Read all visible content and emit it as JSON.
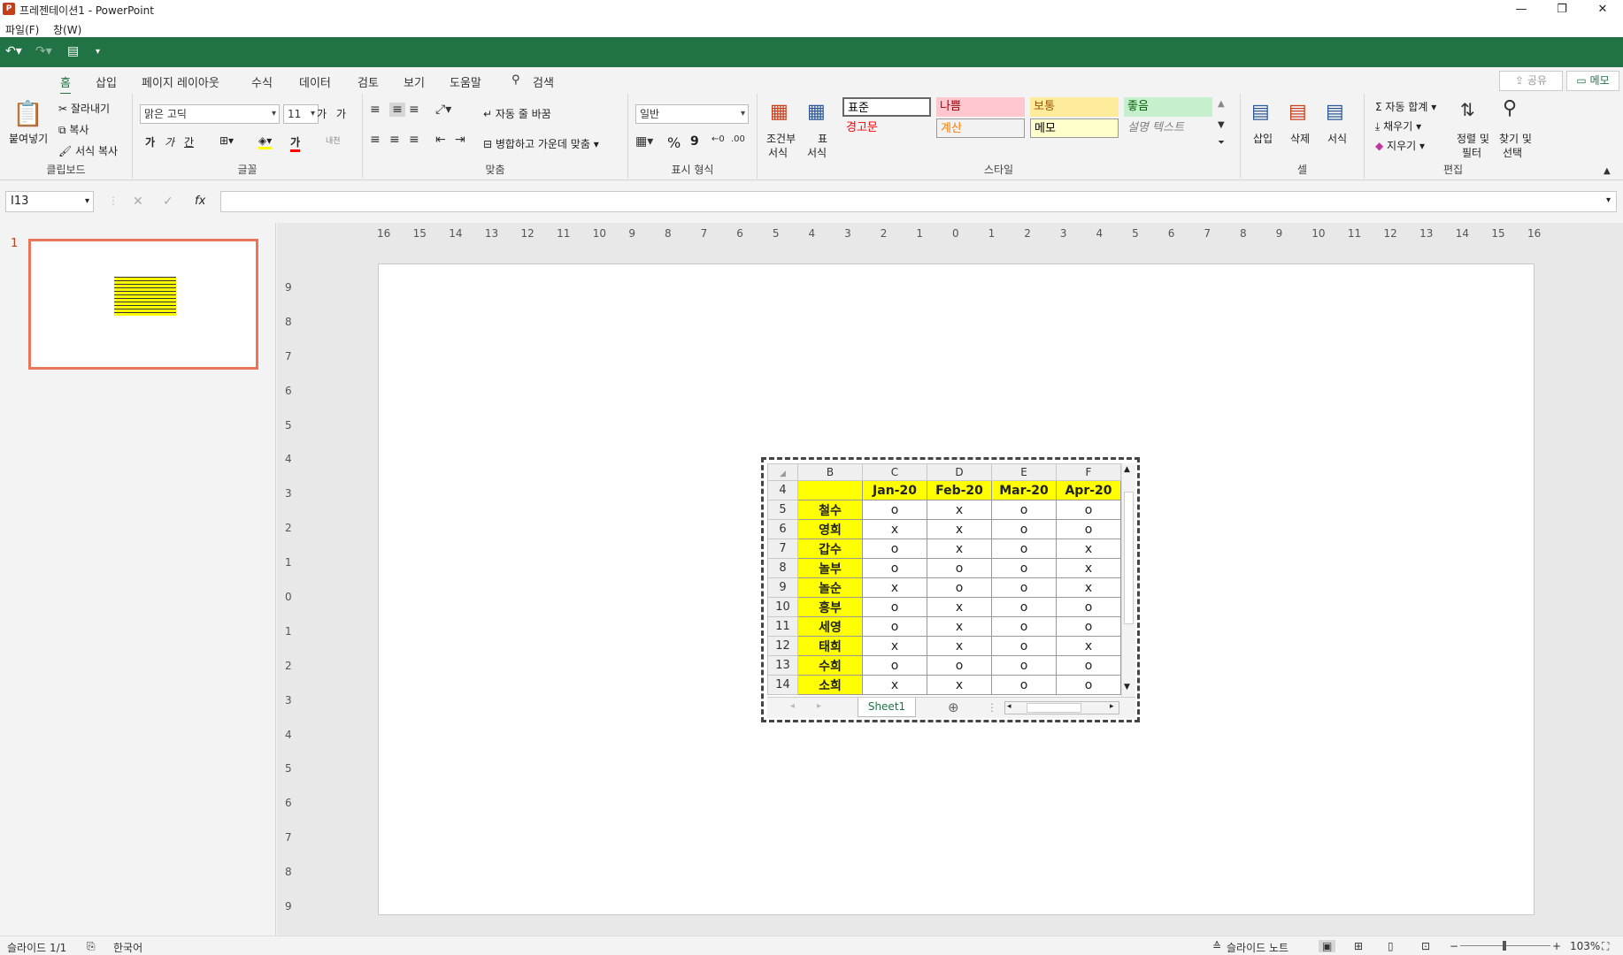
{
  "window": {
    "title": "프레젠테이션1 - PowerPoint",
    "app_icon": "P",
    "controls": {
      "minimize": "—",
      "restore": "❐",
      "close": "✕"
    }
  },
  "menu": {
    "file": "파일(F)",
    "window": "창(W)"
  },
  "tabs": [
    "홈",
    "삽입",
    "페이지 레이아웃",
    "수식",
    "데이터",
    "검토",
    "보기",
    "도움말",
    "검색"
  ],
  "share_label": "공유",
  "memo_label": "메모",
  "ribbon": {
    "clipboard": {
      "paste": "붙여넣기",
      "cut": "잘라내기",
      "copy": "복사",
      "format_copy": "서식 복사",
      "label": "클립보드"
    },
    "font": {
      "name": "맑은 고딕",
      "size": "11",
      "grow": "가",
      "shrink": "가",
      "bold": "가",
      "italic": "가",
      "underline": "간",
      "font_color": "가",
      "phonetic": "내천",
      "label": "글꼴"
    },
    "alignment": {
      "wrap": "자동 줄 바꿈",
      "merge": "병합하고 가운데 맞춤",
      "label": "맞춤"
    },
    "number": {
      "format": "일반",
      "percent": "%",
      "comma": "9",
      "label": "표시 형식"
    },
    "styles": {
      "conditional": [
        "조건부",
        "서식"
      ],
      "table": [
        "표",
        "서식"
      ],
      "cells": [
        {
          "label": "표준",
          "bg": "#ffffff",
          "fg": "#000000"
        },
        {
          "label": "나쁨",
          "bg": "#ffc7ce",
          "fg": "#9c0006"
        },
        {
          "label": "보통",
          "bg": "#ffeb9c",
          "fg": "#9c5700"
        },
        {
          "label": "좋음",
          "bg": "#c6efce",
          "fg": "#006100"
        },
        {
          "label": "경고문",
          "bg": "#f3f3f3",
          "fg": "#ff0000"
        },
        {
          "label": "계산",
          "bg": "#f2f2f2",
          "fg": "#fa7d00"
        },
        {
          "label": "메모",
          "bg": "#ffffcc",
          "fg": "#000000"
        },
        {
          "label": "설명 텍스트",
          "bg": "#f3f3f3",
          "fg": "#7f7f7f"
        }
      ],
      "label": "스타일"
    },
    "cells": {
      "insert": "삽입",
      "delete": "삭제",
      "format": "서식",
      "label": "셀"
    },
    "editing": {
      "autosum": "자동 합계",
      "fill": "채우기",
      "clear": "지우기",
      "sort": [
        "정렬 및",
        "필터"
      ],
      "find": [
        "찾기 및",
        "선택"
      ],
      "label": "편집"
    }
  },
  "formula_bar": {
    "cell_ref": "I13",
    "fx": "fx",
    "cancel": "✕",
    "enter": "✓",
    "formula": ""
  },
  "thumbnail": {
    "number": "1"
  },
  "ruler": {
    "h_labels": [
      "16",
      "15",
      "14",
      "13",
      "12",
      "11",
      "10",
      "9",
      "8",
      "7",
      "6",
      "5",
      "4",
      "3",
      "2",
      "1",
      "0",
      "1",
      "2",
      "3",
      "4",
      "5",
      "6",
      "7",
      "8",
      "9",
      "10",
      "11",
      "12",
      "13",
      "14",
      "15",
      "16"
    ],
    "v_labels": [
      "9",
      "8",
      "7",
      "6",
      "5",
      "4",
      "3",
      "2",
      "1",
      "0",
      "1",
      "2",
      "3",
      "4",
      "5",
      "6",
      "7",
      "8",
      "9"
    ]
  },
  "sheet": {
    "columns": [
      "B",
      "C",
      "D",
      "E",
      "F"
    ],
    "header_row": {
      "row": "4",
      "cells": [
        "",
        "Jan-20",
        "Feb-20",
        "Mar-20",
        "Apr-20"
      ]
    },
    "rows": [
      {
        "row": "5",
        "name": "철수",
        "values": [
          "o",
          "x",
          "o",
          "o"
        ]
      },
      {
        "row": "6",
        "name": "영희",
        "values": [
          "x",
          "x",
          "o",
          "o"
        ]
      },
      {
        "row": "7",
        "name": "갑수",
        "values": [
          "o",
          "x",
          "o",
          "x"
        ]
      },
      {
        "row": "8",
        "name": "놀부",
        "values": [
          "o",
          "o",
          "o",
          "x"
        ]
      },
      {
        "row": "9",
        "name": "놀순",
        "values": [
          "x",
          "o",
          "o",
          "x"
        ]
      },
      {
        "row": "10",
        "name": "흥부",
        "values": [
          "o",
          "x",
          "o",
          "o"
        ]
      },
      {
        "row": "11",
        "name": "세영",
        "values": [
          "o",
          "x",
          "o",
          "o"
        ]
      },
      {
        "row": "12",
        "name": "태희",
        "values": [
          "x",
          "x",
          "o",
          "x"
        ]
      },
      {
        "row": "13",
        "name": "수희",
        "values": [
          "o",
          "o",
          "o",
          "o"
        ]
      },
      {
        "row": "14",
        "name": "소희",
        "values": [
          "x",
          "x",
          "o",
          "o"
        ]
      }
    ],
    "sheet_tab": "Sheet1",
    "add_sheet": "⊕",
    "colors": {
      "highlight": "#ffff00"
    }
  },
  "status": {
    "slide": "슬라이드 1/1",
    "language": "한국어",
    "notes": "슬라이드 노트",
    "zoom": "103%"
  }
}
